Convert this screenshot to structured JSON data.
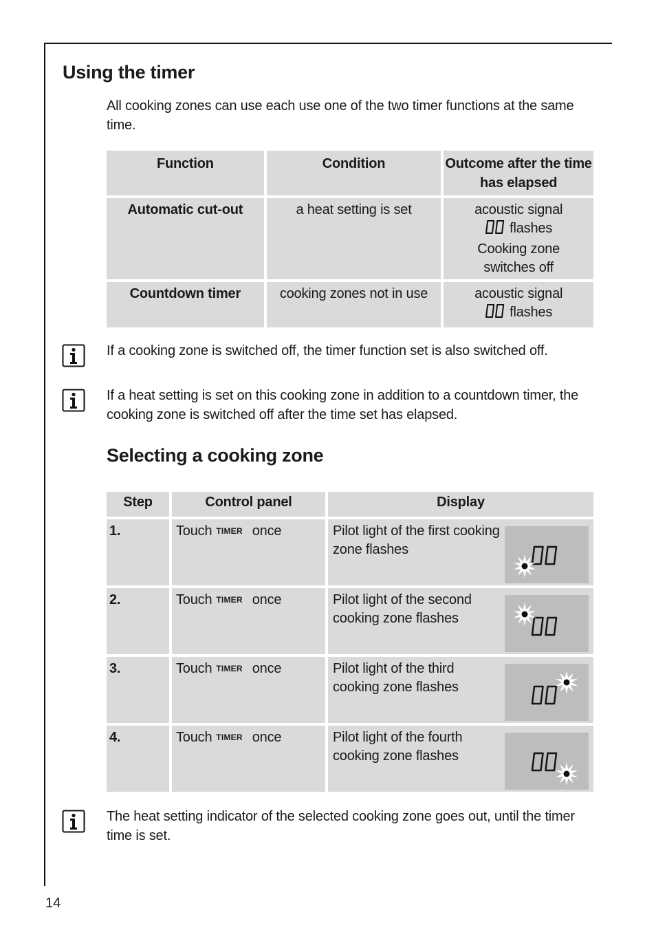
{
  "page_number": "14",
  "section_timer": {
    "title": "Using the timer",
    "intro": "All cooking zones can use each use one of the two timer functions at the same time.",
    "table": {
      "headers": [
        "Function",
        "Condition",
        "Outcome after the time has elapsed"
      ],
      "rows": [
        {
          "function": "Automatic cut-out",
          "condition": "a heat setting is set",
          "outcome": [
            "acoustic signal",
            "flashes",
            "Cooking zone",
            "switches off"
          ],
          "display_symbol": "00"
        },
        {
          "function": "Countdown timer",
          "condition": "cooking zones not in use",
          "outcome": [
            "acoustic signal",
            "flashes"
          ],
          "display_symbol": "00"
        }
      ]
    },
    "notes": [
      {
        "icon": "info-icon",
        "text": "If a cooking zone is switched off, the timer function set is also switched off."
      },
      {
        "icon": "info-icon",
        "text": "If a heat setting is set on this cooking zone in addition to a countdown timer, the cooking zone is switched off after the time set has elapsed."
      }
    ]
  },
  "section_select": {
    "title": "Selecting a cooking zone",
    "table": {
      "headers": [
        "Step",
        "Control panel",
        "Display"
      ],
      "rows": [
        {
          "step": "1.",
          "action_prefix": "Touch",
          "key": "TIMER",
          "action_suffix": "once",
          "display_text": "Pilot light of the first cooking zone flashes",
          "display_value": "00",
          "pilot_position": "bottom-left"
        },
        {
          "step": "2.",
          "action_prefix": "Touch",
          "key": "TIMER",
          "action_suffix": "once",
          "display_text": "Pilot light of the second cooking zone flashes",
          "display_value": "00",
          "pilot_position": "top-left"
        },
        {
          "step": "3.",
          "action_prefix": "Touch",
          "key": "TIMER",
          "action_suffix": "once",
          "display_text": "Pilot light of the third cooking zone flashes",
          "display_value": "00",
          "pilot_position": "top-right"
        },
        {
          "step": "4.",
          "action_prefix": "Touch",
          "key": "TIMER",
          "action_suffix": "once",
          "display_text": "Pilot light of the fourth cooking zone flashes",
          "display_value": "00",
          "pilot_position": "bottom-right"
        }
      ]
    },
    "notes": [
      {
        "icon": "info-icon",
        "text": "The heat setting indicator of the selected cooking zone goes out, until the timer time is set."
      }
    ]
  }
}
